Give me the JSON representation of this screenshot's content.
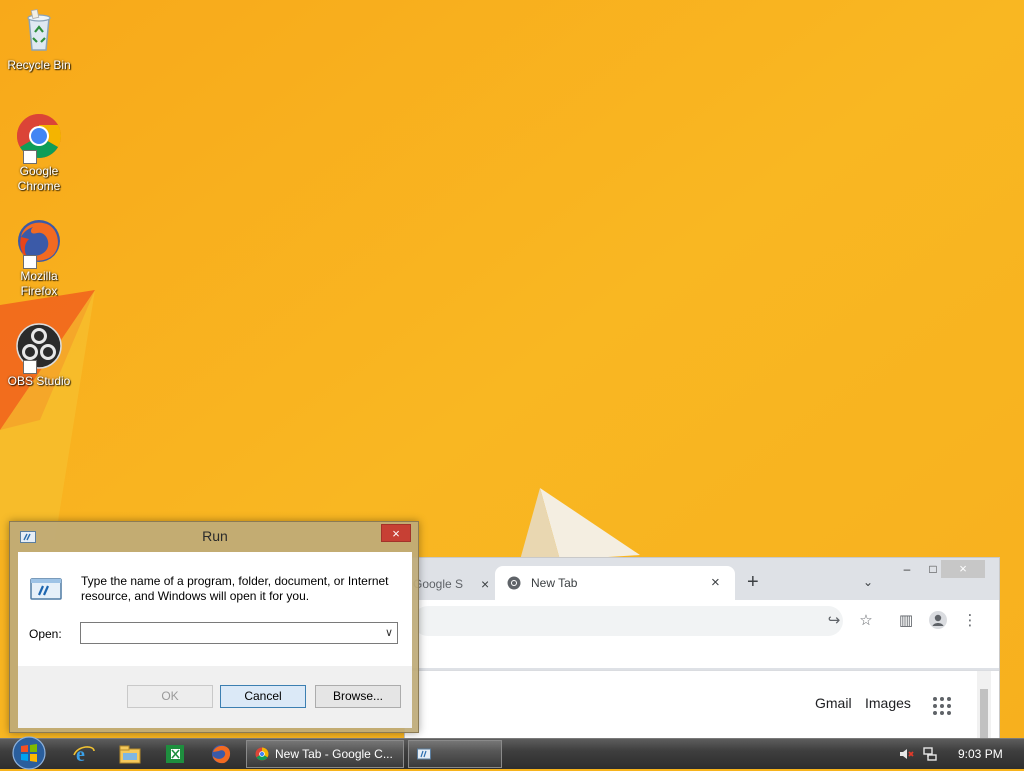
{
  "desktop": {
    "icons": [
      {
        "label": "Recycle Bin",
        "icon": "recycle-bin-icon"
      },
      {
        "label": "Google Chrome",
        "icon": "chrome-icon"
      },
      {
        "label": "Mozilla Firefox",
        "icon": "firefox-icon"
      },
      {
        "label": "OBS Studio",
        "icon": "obs-icon"
      }
    ]
  },
  "chrome": {
    "partial_tab_label": "Google S",
    "active_tab_label": "New Tab",
    "new_tab_glyph": "+",
    "close_glyph": "×",
    "content_links": {
      "gmail": "Gmail",
      "images": "Images"
    }
  },
  "run_dialog": {
    "title": "Run",
    "description": "Type the name of a program, folder, document, or Internet resource, and Windows will open it for you.",
    "open_label": "Open:",
    "open_value": "",
    "buttons": {
      "ok": "OK",
      "cancel": "Cancel",
      "browse": "Browse..."
    }
  },
  "taskbar": {
    "chrome_task_label": "New Tab - Google C...",
    "clock": "9:03 PM"
  },
  "colors": {
    "wallpaper": "#f7b31c",
    "close_red": "#c74034",
    "default_button": "#dbe9f7"
  }
}
